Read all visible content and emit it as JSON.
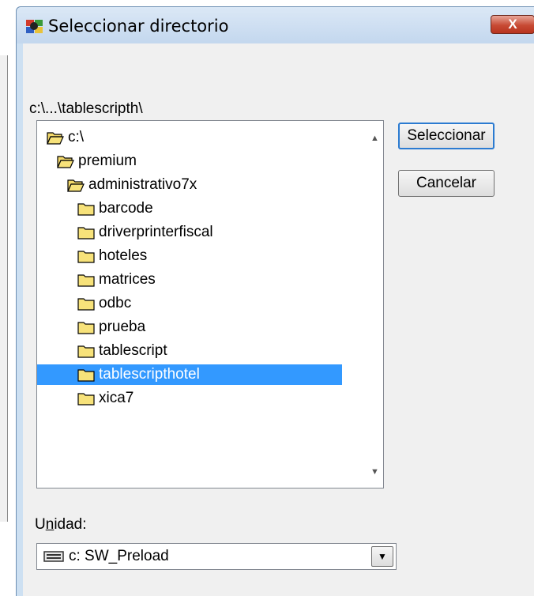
{
  "window": {
    "title": "Seleccionar directorio",
    "close_label": "X"
  },
  "path_label": "c:\\...\\tablescripth\\",
  "tree": {
    "items": [
      {
        "label": "c:\\",
        "level": 0,
        "open": true,
        "selected": false
      },
      {
        "label": "premium",
        "level": 1,
        "open": true,
        "selected": false
      },
      {
        "label": "administrativo7x",
        "level": 2,
        "open": true,
        "selected": false
      },
      {
        "label": "barcode",
        "level": 3,
        "open": false,
        "selected": false
      },
      {
        "label": "driverprinterfiscal",
        "level": 3,
        "open": false,
        "selected": false
      },
      {
        "label": "hoteles",
        "level": 3,
        "open": false,
        "selected": false
      },
      {
        "label": "matrices",
        "level": 3,
        "open": false,
        "selected": false
      },
      {
        "label": "odbc",
        "level": 3,
        "open": false,
        "selected": false
      },
      {
        "label": "prueba",
        "level": 3,
        "open": false,
        "selected": false
      },
      {
        "label": "tablescript",
        "level": 3,
        "open": false,
        "selected": false
      },
      {
        "label": "tablescripthotel",
        "level": 3,
        "open": false,
        "selected": true
      },
      {
        "label": "xica7",
        "level": 3,
        "open": false,
        "selected": false
      }
    ]
  },
  "buttons": {
    "select_label": "Seleccionar",
    "cancel_label": "Cancelar"
  },
  "drive": {
    "label_prefix": "U",
    "label_underlined": "n",
    "label_suffix": "idad:",
    "selected": "c: SW_Preload"
  },
  "colors": {
    "selection": "#3399ff",
    "folder": "#f7e27a",
    "titlebar": "#cde0f2"
  }
}
